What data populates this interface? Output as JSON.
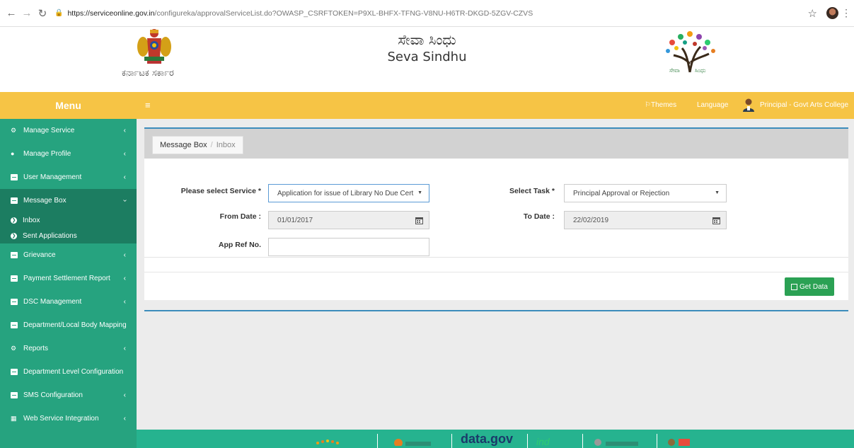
{
  "browser": {
    "url_host": "https://serviceonline.gov.in",
    "url_path": "/configureka/approvalServiceList.do?OWASP_CSRFTOKEN=P9XL-BHFX-TFNG-V8NU-H6TR-DKGD-5ZGV-CZVS"
  },
  "header": {
    "emblem_caption": "ಕರ್ನಾಟಕ ಸರ್ಕಾರ",
    "title_kannada": "ಸೇವಾ ಸಿಂಧು",
    "title_english": "Seva Sindhu",
    "logo_text_left": "ಸೇವಾ",
    "logo_text_right": "ಸಿಂಧು"
  },
  "topbar": {
    "menu_label": "Menu",
    "themes_label": "Themes",
    "language_label": "Language",
    "user_label": "Principal - Govt Arts College",
    "accent_color": "#f6c445"
  },
  "sidebar": {
    "bg_color": "#26a37f",
    "items": [
      {
        "label": "Manage Service",
        "icon": "cogs-icon",
        "has_chevron": true
      },
      {
        "label": "Manage Profile",
        "icon": "users-icon",
        "has_chevron": true
      },
      {
        "label": "User Management",
        "icon": "square-icon",
        "has_chevron": true
      },
      {
        "label": "Message Box",
        "icon": "square-icon",
        "expanded": true
      },
      {
        "label": "Grievance",
        "icon": "square-icon",
        "has_chevron": true
      },
      {
        "label": "Payment Settlement Report",
        "icon": "square-icon",
        "has_chevron": true
      },
      {
        "label": "DSC Management",
        "icon": "square-icon",
        "has_chevron": true
      },
      {
        "label": "Department/Local Body Mapping",
        "icon": "square-icon",
        "has_chevron": false
      },
      {
        "label": "Reports",
        "icon": "cogs-icon",
        "has_chevron": true
      },
      {
        "label": "Department Level Configuration",
        "icon": "square-icon",
        "has_chevron": false
      },
      {
        "label": "SMS Configuration",
        "icon": "square-icon",
        "has_chevron": true
      },
      {
        "label": "Web Service Integration",
        "icon": "map-icon",
        "has_chevron": true
      }
    ],
    "sub_items": [
      "Inbox",
      "Sent Applications"
    ]
  },
  "breadcrumb": {
    "root": "Message Box",
    "separator": "/",
    "current": "Inbox"
  },
  "form": {
    "service_label": "Please select Service *",
    "service_value": "Application for issue of Library No Due Cert",
    "task_label": "Select Task *",
    "task_value": "Principal Approval or Rejection",
    "from_date_label": "From Date :",
    "from_date_value": "01/01/2017",
    "to_date_label": "To Date :",
    "to_date_value": "22/02/2019",
    "app_ref_label": "App Ref No.",
    "app_ref_value": ""
  },
  "actions": {
    "get_data_label": "Get Data",
    "button_color": "#2ba154"
  },
  "footer": {
    "bg_color": "#26b38f",
    "partner_text": "data.gov"
  }
}
